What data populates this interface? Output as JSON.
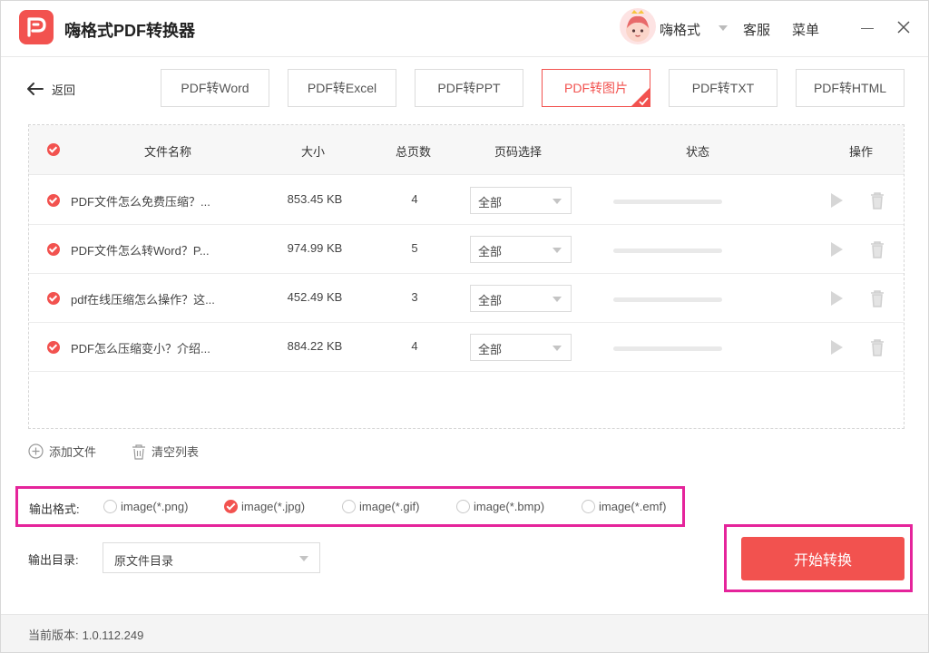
{
  "app": {
    "title": "嗨格式PDF转换器",
    "username": "嗨格式",
    "service_label": "客服",
    "menu_label": "菜单"
  },
  "nav": {
    "back_label": "返回",
    "tabs": [
      {
        "label": "PDF转Word",
        "active": false
      },
      {
        "label": "PDF转Excel",
        "active": false
      },
      {
        "label": "PDF转PPT",
        "active": false
      },
      {
        "label": "PDF转图片",
        "active": true
      },
      {
        "label": "PDF转TXT",
        "active": false
      },
      {
        "label": "PDF转HTML",
        "active": false
      }
    ]
  },
  "table": {
    "headers": {
      "name": "文件名称",
      "size": "大小",
      "pages": "总页数",
      "page_select": "页码选择",
      "status": "状态",
      "action": "操作"
    },
    "rows": [
      {
        "name": "PDF文件怎么免费压缩？...",
        "size": "853.45 KB",
        "pages": "4",
        "page_select": "全部",
        "progress": 0
      },
      {
        "name": "PDF文件怎么转Word？P...",
        "size": "974.99 KB",
        "pages": "5",
        "page_select": "全部",
        "progress": 0
      },
      {
        "name": "pdf在线压缩怎么操作？这...",
        "size": "452.49 KB",
        "pages": "3",
        "page_select": "全部",
        "progress": 0
      },
      {
        "name": "PDF怎么压缩变小？介绍...",
        "size": "884.22 KB",
        "pages": "4",
        "page_select": "全部",
        "progress": 0
      }
    ]
  },
  "actions": {
    "add_file": "添加文件",
    "clear_list": "清空列表"
  },
  "output": {
    "format_label": "输出格式:",
    "formats": [
      {
        "label": "image(*.png)",
        "checked": false
      },
      {
        "label": "image(*.jpg)",
        "checked": true
      },
      {
        "label": "image(*.gif)",
        "checked": false
      },
      {
        "label": "image(*.bmp)",
        "checked": false
      },
      {
        "label": "image(*.emf)",
        "checked": false
      }
    ],
    "dir_label": "输出目录:",
    "dir_value": "原文件目录"
  },
  "start_button": "开始转换",
  "footer": {
    "version_label": "当前版本:",
    "version": "1.0.112.249"
  },
  "colors": {
    "accent": "#f2524f",
    "highlight": "#e5249b"
  }
}
